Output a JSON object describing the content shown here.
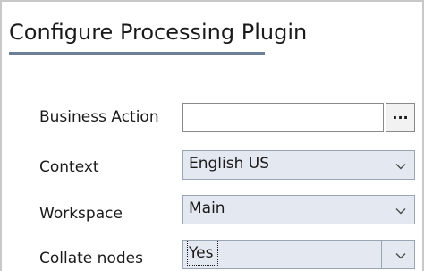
{
  "dialog": {
    "title": "Configure Processing Plugin"
  },
  "fields": {
    "business_action": {
      "label": "Business Action",
      "value": "",
      "browse_label": "..."
    },
    "context": {
      "label": "Context",
      "value": "English US"
    },
    "workspace": {
      "label": "Workspace",
      "value": "Main"
    },
    "collate_nodes": {
      "label": "Collate nodes",
      "value": "Yes"
    }
  },
  "icons": {
    "dropdown": "chevron-down-icon"
  },
  "colors": {
    "title_underline": "#6b8096",
    "select_background": "#e4e9f1",
    "select_border": "#9aa5b4"
  }
}
